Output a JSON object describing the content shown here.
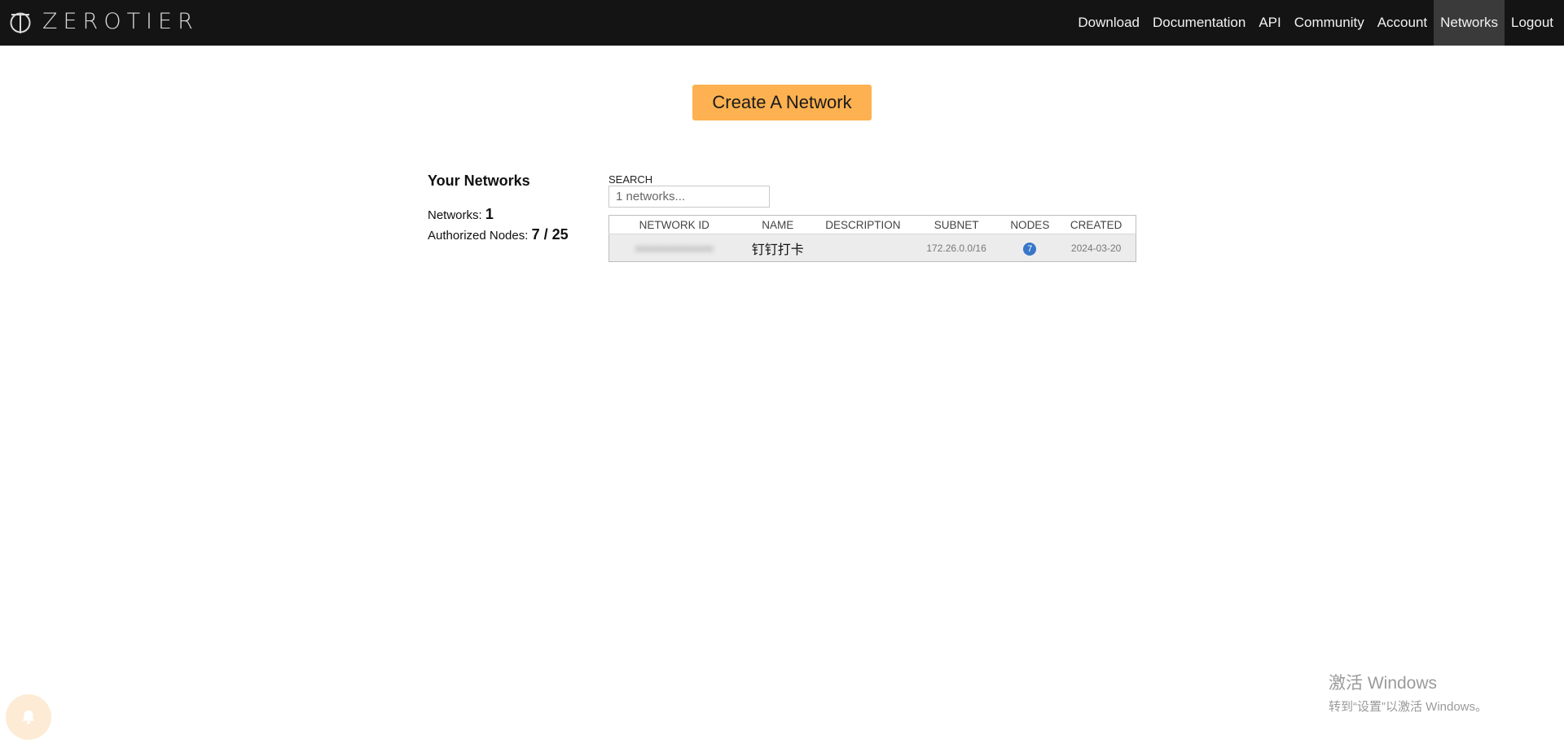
{
  "header": {
    "brand": "ZEROTIER",
    "nav": [
      {
        "label": "Download"
      },
      {
        "label": "Documentation"
      },
      {
        "label": "API"
      },
      {
        "label": "Community"
      },
      {
        "label": "Account"
      },
      {
        "label": "Networks",
        "active": true
      },
      {
        "label": "Logout"
      }
    ]
  },
  "main": {
    "create_button": "Create A Network",
    "summary": {
      "heading": "Your Networks",
      "networks_label": "Networks:",
      "networks_count": "1",
      "nodes_label": "Authorized Nodes:",
      "nodes_value": "7 / 25"
    },
    "search": {
      "label": "SEARCH",
      "placeholder": "1 networks..."
    },
    "table": {
      "columns": [
        "NETWORK ID",
        "NAME",
        "DESCRIPTION",
        "SUBNET",
        "NODES",
        "CREATED"
      ],
      "rows": [
        {
          "network_id": "xxxxxxxxxxxxxxxx",
          "name": "钉钉打卡",
          "description": "",
          "subnet": "172.26.0.0/16",
          "nodes": "7",
          "created": "2024-03-20"
        }
      ]
    }
  },
  "watermark": {
    "title": "激活 Windows",
    "subtitle": "转到“设置”以激活 Windows。"
  },
  "colors": {
    "topbar": "#141414",
    "accent_button": "#fdb150",
    "nodes_badge": "#3876c9",
    "active_nav": "#3a3a3a"
  },
  "icons": {
    "brand_logo": "zerotier-logo-icon",
    "notification": "bell-icon"
  }
}
